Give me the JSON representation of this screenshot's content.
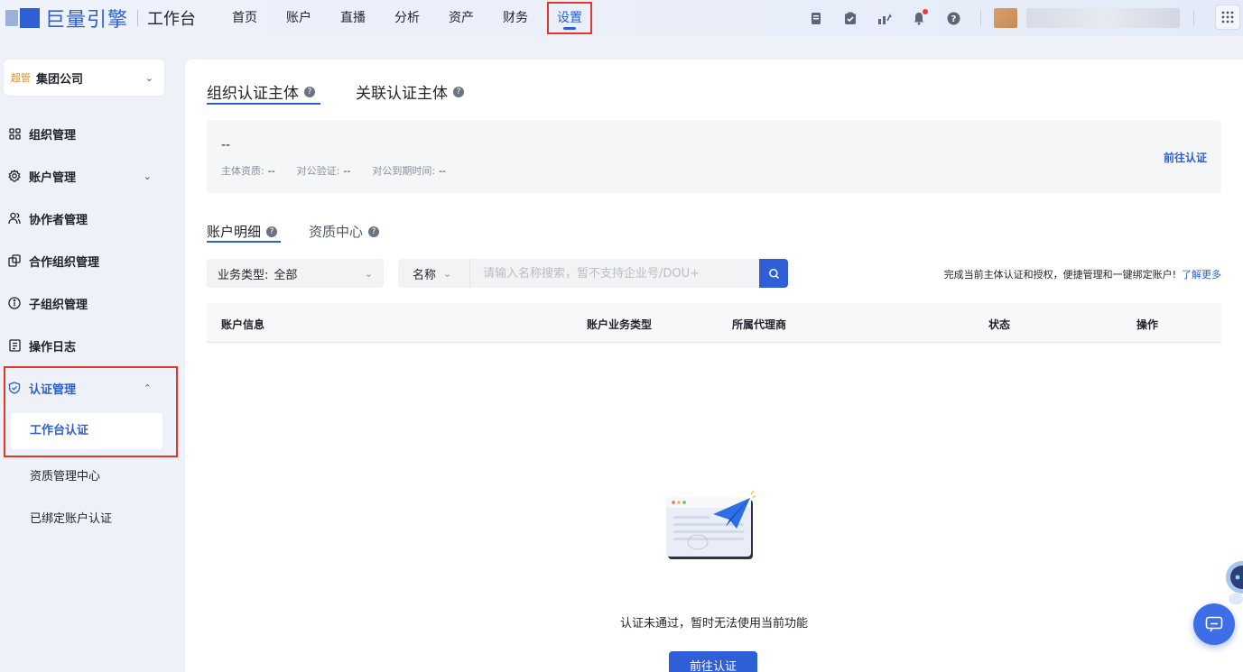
{
  "topbar": {
    "brand_name": "巨量引擎",
    "brand_sub": "工作台",
    "nav": [
      {
        "label": "首页"
      },
      {
        "label": "账户"
      },
      {
        "label": "直播"
      },
      {
        "label": "分析"
      },
      {
        "label": "资产"
      },
      {
        "label": "财务"
      },
      {
        "label": "设置",
        "active": true
      }
    ]
  },
  "sidebar": {
    "org_badge": "超管",
    "org_name": "集团公司",
    "items": [
      {
        "label": "组织管理",
        "icon": "grid-icon"
      },
      {
        "label": "账户管理",
        "icon": "gear-icon",
        "expandable": true
      },
      {
        "label": "协作者管理",
        "icon": "users-icon"
      },
      {
        "label": "合作组织管理",
        "icon": "link-org-icon"
      },
      {
        "label": "子组织管理",
        "icon": "info-circle-icon"
      },
      {
        "label": "操作日志",
        "icon": "log-icon"
      },
      {
        "label": "认证管理",
        "icon": "shield-check-icon",
        "expanded": true
      }
    ],
    "sub_items": [
      {
        "label": "工作台认证",
        "active": true
      },
      {
        "label": "资质管理中心"
      },
      {
        "label": "已绑定账户认证"
      }
    ]
  },
  "main": {
    "tabs": [
      {
        "label": "组织认证主体",
        "active": true
      },
      {
        "label": "关联认证主体"
      }
    ],
    "info": {
      "title": "--",
      "meta": [
        {
          "label": "主体资质:",
          "value": "--"
        },
        {
          "label": "对公验证:",
          "value": "--"
        },
        {
          "label": "对公到期时间:",
          "value": "--"
        }
      ],
      "goto_label": "前往认证"
    },
    "subtabs": [
      {
        "label": "账户明细",
        "active": true
      },
      {
        "label": "资质中心"
      }
    ],
    "filter": {
      "type_label": "业务类型:",
      "type_value": "全部",
      "key_label": "名称",
      "search_placeholder": "请输入名称搜索，暂不支持企业号/DOU+"
    },
    "tip": {
      "text": "完成当前主体认证和授权，便捷管理和一键绑定账户!",
      "link": "了解更多"
    },
    "table": {
      "columns": [
        "账户信息",
        "账户业务类型",
        "所属代理商",
        "状态",
        "操作"
      ]
    },
    "empty": {
      "text": "认证未通过，暂时无法使用当前功能",
      "button": "前往认证"
    }
  },
  "colors": {
    "accent": "#2f5fd6",
    "highlight_box": "#e0392b",
    "badge": "#e88a20"
  }
}
